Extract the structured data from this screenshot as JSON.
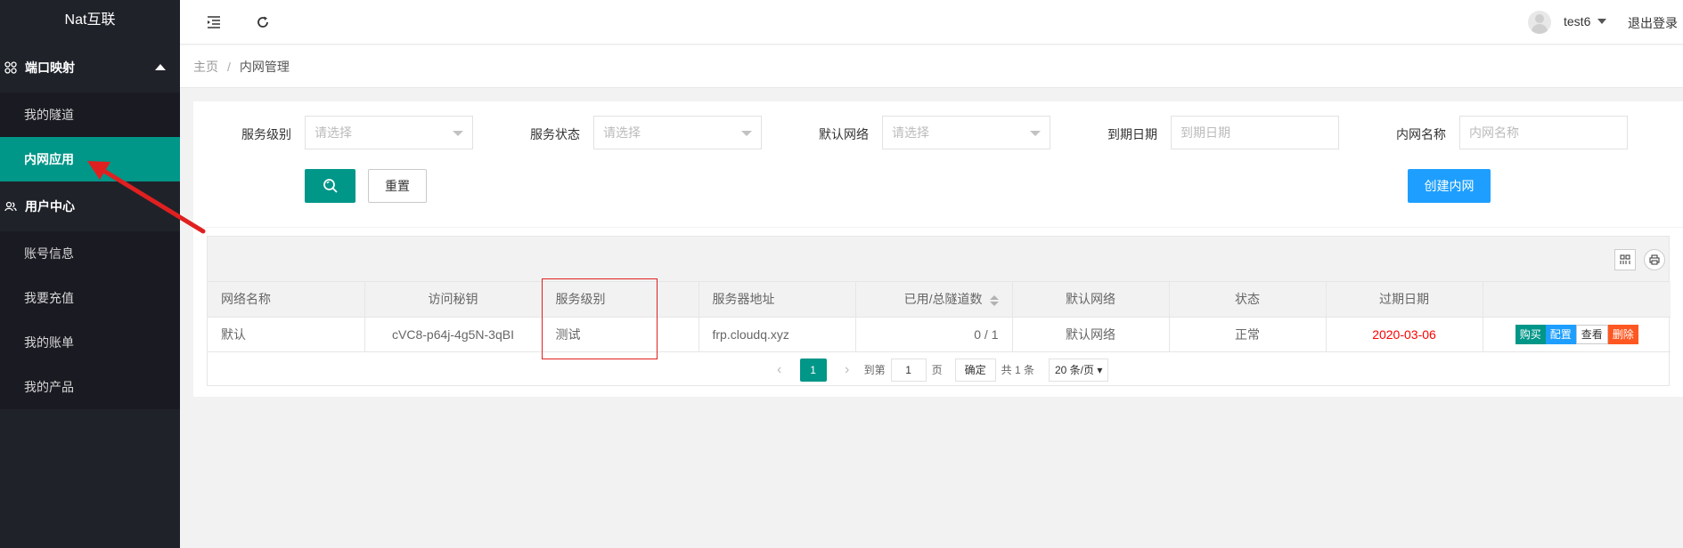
{
  "app": {
    "logo": "Nat互联"
  },
  "sidebar": {
    "groups": [
      {
        "label": "端口映射",
        "icon": "grid-icon",
        "items": [
          {
            "label": "我的隧道"
          },
          {
            "label": "内网应用"
          }
        ]
      },
      {
        "label": "用户中心",
        "icon": "users-icon",
        "items": [
          {
            "label": "账号信息"
          },
          {
            "label": "我要充值"
          },
          {
            "label": "我的账单"
          },
          {
            "label": "我的产品"
          }
        ]
      }
    ]
  },
  "header": {
    "username": "test6",
    "logout": "退出登录"
  },
  "breadcrumb": {
    "home": "主页",
    "sep": "/",
    "current": "内网管理"
  },
  "filters": {
    "level_label": "服务级别",
    "level_ph": "请选择",
    "status_label": "服务状态",
    "status_ph": "请选择",
    "network_label": "默认网络",
    "network_ph": "请选择",
    "expire_label": "到期日期",
    "expire_ph": "到期日期",
    "name_label": "内网名称",
    "name_ph": "内网名称",
    "reset": "重置",
    "create": "创建内网"
  },
  "table": {
    "headers": [
      "网络名称",
      "访问秘钥",
      "服务级别",
      "服务器地址",
      "已用/总隧道数",
      "默认网络",
      "状态",
      "过期日期",
      ""
    ],
    "rows": [
      {
        "name": "默认",
        "key": "cVC8-p64j-4g5N-3qBI",
        "level": "测试",
        "server": "frp.cloudq.xyz",
        "tunnels": "0 / 1",
        "network": "默认网络",
        "status": "正常",
        "expire": "2020-03-06",
        "ops": {
          "buy": "购买",
          "config": "配置",
          "view": "查看",
          "delete": "删除"
        }
      }
    ]
  },
  "pager": {
    "current": "1",
    "goto": "到第",
    "page_input": "1",
    "page_unit": "页",
    "confirm": "确定",
    "total": "共 1 条",
    "size": "20 条/页"
  },
  "colors": {
    "accent": "#009688",
    "primary": "#1e9fff",
    "danger": "#ff5722",
    "sidebar": "#20222a"
  }
}
